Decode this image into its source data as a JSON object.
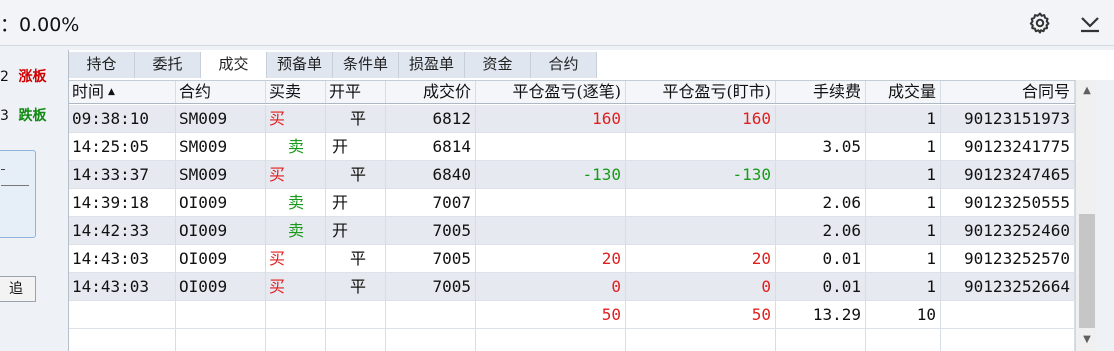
{
  "header": {
    "ratio_text": "：0.00%",
    "settings_icon": "gear-icon",
    "collapse_icon": "collapse-down-icon"
  },
  "left_panel": {
    "rows": [
      {
        "num": "2",
        "label": "涨板",
        "color": "#d00000"
      },
      {
        "num": "3",
        "label": "跌板",
        "color": "#118a11"
      }
    ],
    "button_label": "追"
  },
  "tabs": [
    {
      "label": "持仓",
      "active": false
    },
    {
      "label": "委托",
      "active": false
    },
    {
      "label": "成交",
      "active": true
    },
    {
      "label": "预备单",
      "active": false
    },
    {
      "label": "条件单",
      "active": false
    },
    {
      "label": "损盈单",
      "active": false
    },
    {
      "label": "资金",
      "active": false
    },
    {
      "label": "合约",
      "active": false
    }
  ],
  "table": {
    "columns": [
      "时间",
      "合约",
      "买卖",
      "开平",
      "成交价",
      "平仓盈亏(逐笔)",
      "平仓盈亏(盯市)",
      "手续费",
      "成交量",
      "合同号"
    ],
    "sort_indicator": "▲",
    "rows": [
      {
        "time": "09:38:10",
        "contract": "SM009",
        "side": "买",
        "openclose": "平",
        "price": "6812",
        "pnl_trade": "160",
        "pnl_mtm": "160",
        "fee": "",
        "qty": "1",
        "order_no": "90123151973"
      },
      {
        "time": "14:25:05",
        "contract": "SM009",
        "side": "卖",
        "openclose": "开",
        "price": "6814",
        "pnl_trade": "",
        "pnl_mtm": "",
        "fee": "3.05",
        "qty": "1",
        "order_no": "90123241775"
      },
      {
        "time": "14:33:37",
        "contract": "SM009",
        "side": "买",
        "openclose": "平",
        "price": "6840",
        "pnl_trade": "-130",
        "pnl_mtm": "-130",
        "fee": "",
        "qty": "1",
        "order_no": "90123247465"
      },
      {
        "time": "14:39:18",
        "contract": "OI009",
        "side": "卖",
        "openclose": "开",
        "price": "7007",
        "pnl_trade": "",
        "pnl_mtm": "",
        "fee": "2.06",
        "qty": "1",
        "order_no": "90123250555"
      },
      {
        "time": "14:42:33",
        "contract": "OI009",
        "side": "卖",
        "openclose": "开",
        "price": "7005",
        "pnl_trade": "",
        "pnl_mtm": "",
        "fee": "2.06",
        "qty": "1",
        "order_no": "90123252460"
      },
      {
        "time": "14:43:03",
        "contract": "OI009",
        "side": "买",
        "openclose": "平",
        "price": "7005",
        "pnl_trade": "20",
        "pnl_mtm": "20",
        "fee": "0.01",
        "qty": "1",
        "order_no": "90123252570"
      },
      {
        "time": "14:43:03",
        "contract": "OI009",
        "side": "买",
        "openclose": "平",
        "price": "7005",
        "pnl_trade": "0",
        "pnl_mtm": "0",
        "fee": "0.01",
        "qty": "1",
        "order_no": "90123252664"
      }
    ],
    "totals": {
      "pnl_trade": "50",
      "pnl_mtm": "50",
      "fee": "13.29",
      "qty": "10"
    }
  },
  "colors": {
    "buy": "#e02020",
    "sell": "#1a9a1a",
    "profit": "#e02020",
    "loss": "#1a9a1a",
    "row_alt": "#e6eaf0",
    "tab_bg": "#dfe6f0"
  }
}
